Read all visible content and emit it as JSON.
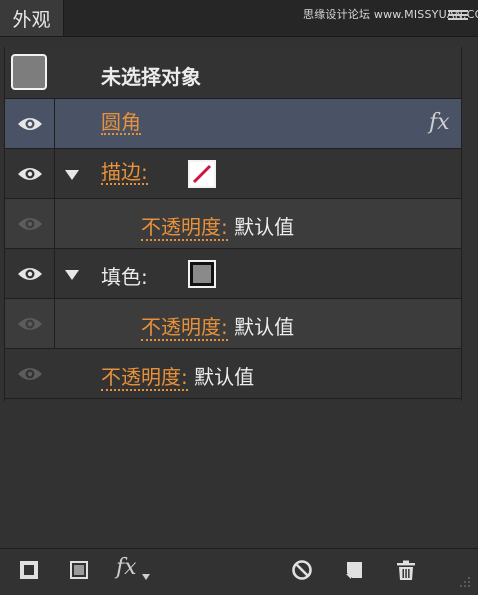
{
  "tab": {
    "label": "外观"
  },
  "watermark": "思缘设计论坛 www.MISSYUAN.COM",
  "header_row": {
    "label": "未选择对象"
  },
  "rows": [
    {
      "label": "圆角",
      "suffix": "",
      "fx": "fx"
    },
    {
      "label": "描边",
      "colon": ":"
    },
    {
      "label": "不透明度",
      "colon": ":",
      "value": "默认值"
    },
    {
      "label": "填色",
      "colon": ":"
    },
    {
      "label": "不透明度",
      "colon": ":",
      "value": "默认值"
    },
    {
      "label": "不透明度",
      "colon": ":",
      "value": "默认值"
    }
  ],
  "toolbar": {
    "fx_label": "fx"
  },
  "colors": {
    "accent": "#e8913b",
    "selected_row": "#4a5366",
    "stroke_swatch": "#d0143c",
    "fill_swatch": "#8a8a8a"
  }
}
